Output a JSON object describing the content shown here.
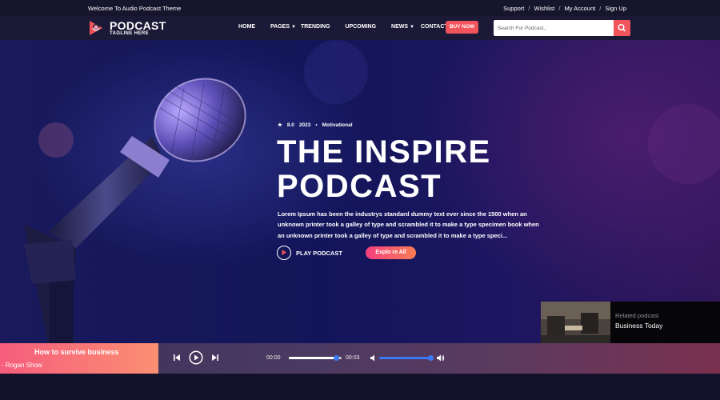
{
  "topbar": {
    "welcome": "Welcome To Audio Podcast Theme",
    "links": [
      "Support",
      "Wishlist",
      "My Account",
      "Sign Up"
    ],
    "separator": "/"
  },
  "nav": {
    "logo_title": "PODCAST",
    "logo_tagline": "TAGLINE HERE",
    "items": [
      {
        "label": "HOME"
      },
      {
        "label": "PAGES",
        "dropdown": true
      },
      {
        "label": "TRENDING"
      },
      {
        "label": "UPCOMING"
      },
      {
        "label": "NEWS",
        "dropdown": true
      },
      {
        "label": "CONTACT"
      }
    ],
    "buy_label": "BUY NOW",
    "search_placeholder": "Search For Podcast..",
    "accent": "#f2545b"
  },
  "hero": {
    "rating": "8.0",
    "year": "2023",
    "genre": "Motivational",
    "title_line1": "THE INSPIRE",
    "title_line2": "PODCAST",
    "description": "Lorem Ipsum has been the industrys standard dummy text ever since the 1500 when an unknown printer took a galley of type and scrambled it to make a type specimen book when an unknown printer took a galley of type and scrambled it to make a type speci...",
    "play_label": "PLAY PODCAST",
    "explore_label": "Explo re All"
  },
  "related": {
    "small": "Related podcast",
    "title": "Business Today"
  },
  "player": {
    "title": "How to survive business",
    "subtitle": "- Rogan Show",
    "time_current": "00:00",
    "time_total": "00:03",
    "progress": 0.9,
    "volume": 1.0
  }
}
